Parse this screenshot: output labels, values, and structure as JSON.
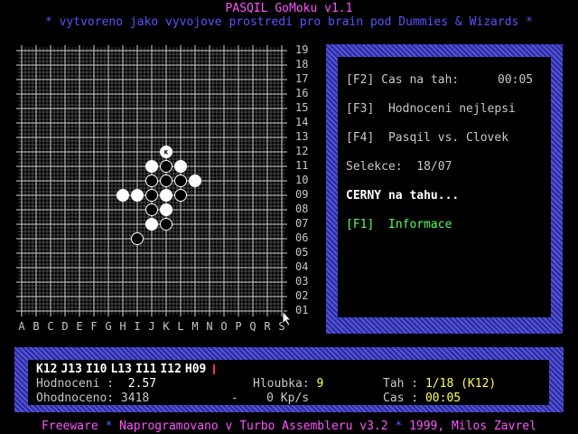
{
  "header": {
    "title": "PASQIL GoMoku v1.1",
    "subtitle": "* vytvoreno jako vyvojove prostredi pro brain pod Dummies & Wizards *"
  },
  "board": {
    "columns": [
      "A",
      "B",
      "C",
      "D",
      "E",
      "F",
      "G",
      "H",
      "I",
      "J",
      "K",
      "L",
      "M",
      "N",
      "O",
      "P",
      "Q",
      "R",
      "S"
    ],
    "rows": [
      "19",
      "18",
      "17",
      "16",
      "15",
      "14",
      "13",
      "12",
      "11",
      "10",
      "09",
      "08",
      "07",
      "06",
      "05",
      "04",
      "03",
      "02",
      "01"
    ],
    "last_move_marker": "K",
    "stones": [
      {
        "col": "K",
        "row": 12,
        "color": "white",
        "last": true
      },
      {
        "col": "J",
        "row": 11,
        "color": "white"
      },
      {
        "col": "K",
        "row": 11,
        "color": "black"
      },
      {
        "col": "L",
        "row": 11,
        "color": "white"
      },
      {
        "col": "J",
        "row": 10,
        "color": "black"
      },
      {
        "col": "K",
        "row": 10,
        "color": "black"
      },
      {
        "col": "L",
        "row": 10,
        "color": "black"
      },
      {
        "col": "M",
        "row": 10,
        "color": "white"
      },
      {
        "col": "H",
        "row": 9,
        "color": "white"
      },
      {
        "col": "I",
        "row": 9,
        "color": "white"
      },
      {
        "col": "J",
        "row": 9,
        "color": "black"
      },
      {
        "col": "K",
        "row": 9,
        "color": "white"
      },
      {
        "col": "L",
        "row": 9,
        "color": "black"
      },
      {
        "col": "J",
        "row": 8,
        "color": "black"
      },
      {
        "col": "K",
        "row": 8,
        "color": "white"
      },
      {
        "col": "J",
        "row": 7,
        "color": "white"
      },
      {
        "col": "K",
        "row": 7,
        "color": "black"
      },
      {
        "col": "I",
        "row": 6,
        "color": "black"
      }
    ]
  },
  "panel": {
    "f2_key": "[F2]",
    "f2_label": "Cas na tah:",
    "f2_value": "00:05",
    "f3_key": "[F3]",
    "f3_label": "Hodnoceni nejlepsi",
    "f4_key": "[F4]",
    "f4_label": "Pasqil vs. Clovek",
    "selekce_label": "Selekce:",
    "selekce_value": "18/07",
    "turn_color": "CERNY",
    "turn_text": "na tahu...",
    "f1_key": "[F1]",
    "f1_label": "Informace"
  },
  "status": {
    "moves": [
      "K12",
      "J13",
      "I10",
      "L13",
      "I11",
      "I12",
      "H09"
    ],
    "hodnoceni_label": "Hodnoceni :",
    "hodnoceni_value": "2.57",
    "ohodnoceno_label": "Ohodnoceno:",
    "ohodnoceno_value": "3418",
    "speed_dash": "-",
    "speed_value": "0 Kp/s",
    "hloubka_label": "Hloubka:",
    "hloubka_value": "9",
    "tah_label": "Tah :",
    "tah_value": "1/18 (K12)",
    "cas_label": "Cas :",
    "cas_value": "00:05"
  },
  "footer": {
    "part1": "Freeware",
    "sep1": " * ",
    "part2": "Naprogramovano v Turbo Assembleru v3.2",
    "sep2": " * ",
    "part3": "1999, Milos Zavrel"
  },
  "colors": {
    "title": "#ff55ff",
    "accent_blue": "#5555ff",
    "frame": "#3a3ab8",
    "green": "#55ff55",
    "yellow": "#ffff55"
  }
}
